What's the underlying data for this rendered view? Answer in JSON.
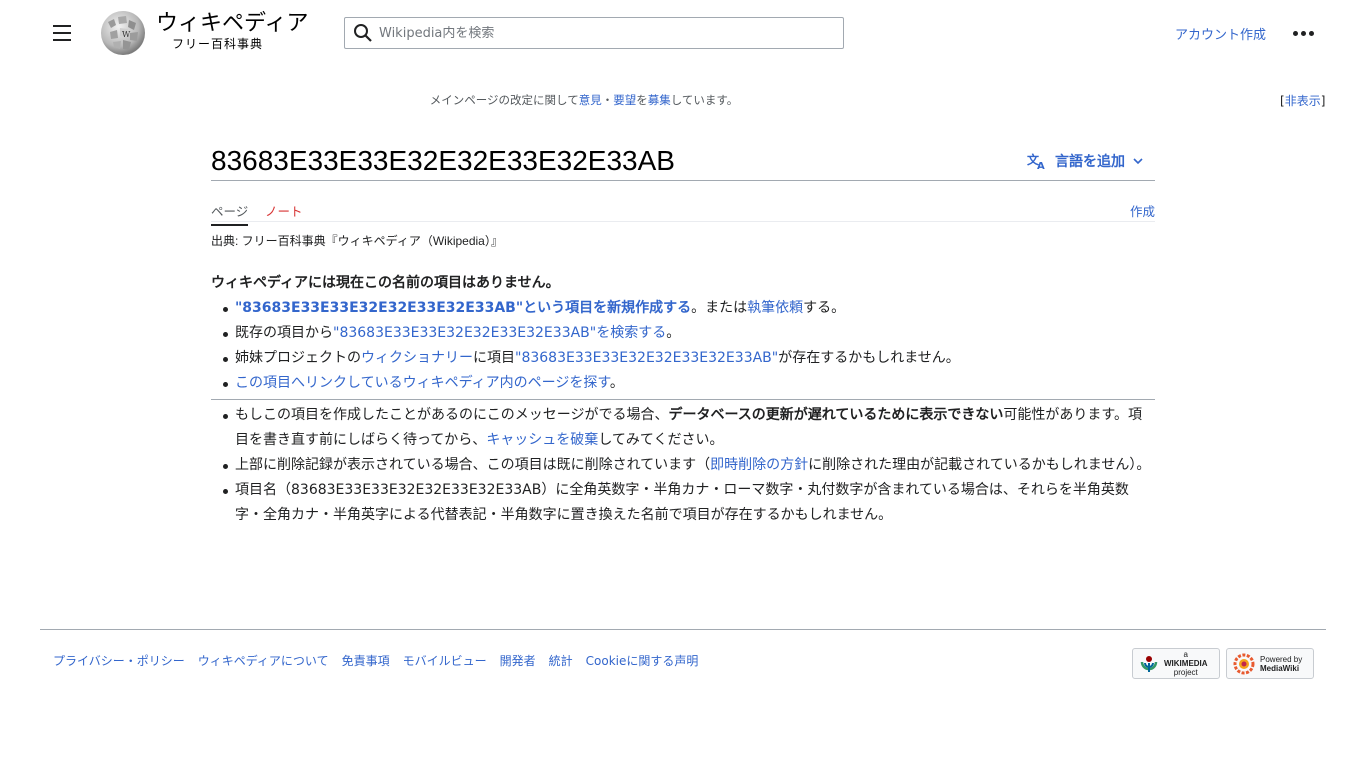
{
  "header": {
    "wordmark_title": "ウィキペディア",
    "wordmark_tagline": "フリー百科事典",
    "search_placeholder": "Wikipedia内を検索",
    "account_create": "アカウント作成"
  },
  "sitenotice": {
    "text_pre": "メインページの改定に関して",
    "link1": "意見",
    "sep": "・",
    "link2": "要望",
    "text_mid": "を",
    "link3": "募集",
    "text_post": "しています。",
    "hide_open": "[",
    "hide_label": "非表示",
    "hide_close": "]"
  },
  "page": {
    "title": "83683E33E33E32E32E33E32E33AB",
    "add_languages": "言語を追加",
    "tab_page": "ページ",
    "tab_talk": "ノート",
    "tab_create": "作成",
    "site_sub": "出典: フリー百科事典『ウィキペディア（Wikipedia）』"
  },
  "content": {
    "lead": "ウィキペディアには現在この名前の項目はありません。",
    "item1_link": "\"83683E33E33E32E32E33E32E33AB\"という項目を新規作成する",
    "item1_mid": "。または",
    "item1_link2": "執筆依頼",
    "item1_post": "する。",
    "item2_pre": "既存の項目から",
    "item2_link": "\"83683E33E33E32E32E33E32E33AB\"を検索する",
    "item2_post": "。",
    "item3_pre": "姉妹プロジェクトの",
    "item3_link1": "ウィクショナリー",
    "item3_mid": "に項目",
    "item3_link2": "\"83683E33E33E32E32E33E32E33AB\"",
    "item3_post": "が存在するかもしれません。",
    "item4_link": "この項目へリンクしているウィキペディア内のページを探す",
    "item4_post": "。",
    "item5_pre": "もしこの項目を作成したことがあるのにこのメッセージがでる場合、",
    "item5_bold": "データベースの更新が遅れているために表示できない",
    "item5_mid": "可能性があります。項目を書き直す前にしばらく待ってから、",
    "item5_link": "キャッシュを破棄",
    "item5_post": "してみてください。",
    "item6_pre": "上部に削除記録が表示されている場合、この項目は既に削除されています（",
    "item6_link": "即時削除の方針",
    "item6_post": "に削除された理由が記載されているかもしれません）。",
    "item7": "項目名（83683E33E33E32E32E33E32E33AB）に全角英数字・半角カナ・ローマ数字・丸付数字が含まれている場合は、それらを半角英数字・全角カナ・半角英字による代替表記・半角数字に置き換えた名前で項目が存在するかもしれません。"
  },
  "footer": {
    "links": [
      "プライバシー・ポリシー",
      "ウィキペディアについて",
      "免責事項",
      "モバイルビュー",
      "開発者",
      "統計",
      "Cookieに関する声明"
    ],
    "wikimedia_badge_top": "a",
    "wikimedia_badge_main": "WIKIMEDIA",
    "wikimedia_badge_sub": "project",
    "mediawiki_badge_top": "Powered by",
    "mediawiki_badge_main": "MediaWiki"
  },
  "colors": {
    "link": "#3366cc",
    "redlink": "#d73333",
    "text": "#202122",
    "border": "#a2a9b1"
  },
  "icons": [
    "menu-icon",
    "wikipedia-globe-logo",
    "search-icon",
    "more-options-icon",
    "language-icon",
    "chevron-down-icon",
    "wikimedia-logo",
    "mediawiki-logo"
  ]
}
